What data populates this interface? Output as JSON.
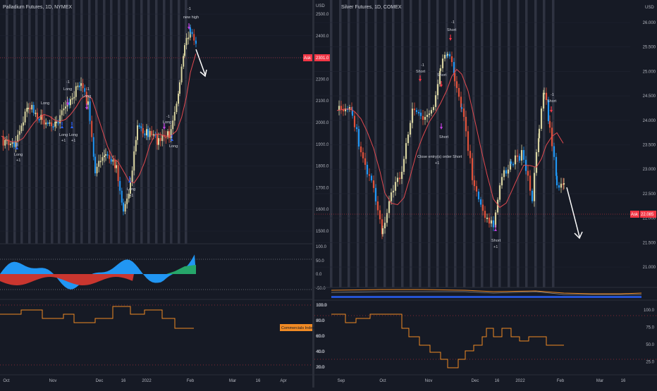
{
  "left": {
    "title": "Palladium Futures, 1D, NYMEX",
    "price_axis": [
      "2500.0",
      "2400.0",
      "2300.0",
      "2200.0",
      "2100.0",
      "2000.0",
      "1900.0",
      "1800.0",
      "1700.0",
      "1600.0",
      "1500.0"
    ],
    "currency": "USD",
    "ask_label": "Ask",
    "ask_price": "2301.0",
    "osc_axis": [
      "100.0",
      "50.0",
      "0.0",
      "-50.0"
    ],
    "cot_axis": [
      "100.0",
      "80.0",
      "60.0",
      "40.0",
      "20.0"
    ],
    "cot_badge": "Commercials Index",
    "time_axis": [
      "Oct",
      "Nov",
      "Dec",
      "16",
      "2022",
      "Feb",
      "Mar",
      "16",
      "Apr"
    ],
    "annotations": {
      "top_num": "-1",
      "top_text": "new high",
      "n1": "-1",
      "long1": "Long",
      "long2": "Long",
      "n2": "-1",
      "long3": "Long",
      "long4": "Long",
      "p1": "+1",
      "long5": "Long",
      "p2": "+1",
      "long6": "Long",
      "p3": "+1",
      "long7": "Long",
      "n3": "-1",
      "long8": "Long",
      "long9": "Long",
      "p4": "+1"
    }
  },
  "right": {
    "title": "Silver Futures, 1D, COMEX",
    "price_axis": [
      "26.000",
      "25.500",
      "25.000",
      "24.500",
      "24.000",
      "23.500",
      "23.000",
      "22.500",
      "22.000",
      "21.500",
      "21.000"
    ],
    "currency": "USD",
    "ask_label": "Ask",
    "ask_price": "22.085",
    "cot_axis": [
      "100.0",
      "75.0",
      "50.0",
      "25.0"
    ],
    "cot_axis_left": [
      "100.0",
      "80.0",
      "60.0",
      "40.0",
      "20.0"
    ],
    "time_axis": [
      "Sep",
      "Oct",
      "Nov",
      "Dec",
      "16",
      "2022",
      "Feb",
      "Mar",
      "16"
    ],
    "annotations": {
      "n1": "-1",
      "short1": "Short",
      "n2": "-1",
      "short2": "Short",
      "short3": "Short",
      "short4": "Short",
      "close_text": "Close entry(s) order Short",
      "p1": "+1",
      "n3": "-1",
      "short5": "Short",
      "short6": "Short",
      "p2": "+1"
    }
  },
  "colors": {
    "background": "#161a25",
    "up_candle": "#d8d3a0",
    "down_candle": "#2196f3",
    "red_candle": "#e0513a",
    "ma_line": "#e0494f",
    "cot_line": "#f08a24",
    "osc_blue": "#2196f3",
    "osc_red": "#c9362f",
    "osc_green": "#26a66a",
    "ask_bg": "#f23645",
    "signal_magenta": "#c040e0"
  }
}
